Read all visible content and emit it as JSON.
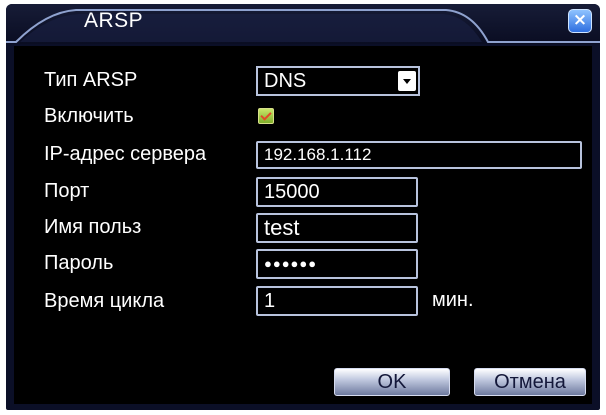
{
  "title": "ARSP",
  "close_glyph": "×",
  "fields": {
    "type_label": "Тип ARSP",
    "type_value": "DNS",
    "enable_label": "Включить",
    "enable_checked": true,
    "ip_label": "IP-адрес сервера",
    "ip_value": "192.168.1.112",
    "port_label": "Порт",
    "port_value": "15000",
    "user_label": "Имя польз",
    "user_value": "test",
    "pass_label": "Пароль",
    "pass_value": "●●●●●●",
    "cycle_label": "Время цикла",
    "cycle_value": "1",
    "cycle_unit": "мин."
  },
  "buttons": {
    "ok": "OK",
    "cancel": "Отмена"
  },
  "colors": {
    "background": "#000000",
    "title_bar": "#0b0f27",
    "field_border": "#b8c3dd",
    "text": "#ffffff"
  },
  "icons": {
    "close": "close-icon",
    "dropdown": "chevron-down-icon",
    "checkbox": "checkbox-checked-icon"
  }
}
